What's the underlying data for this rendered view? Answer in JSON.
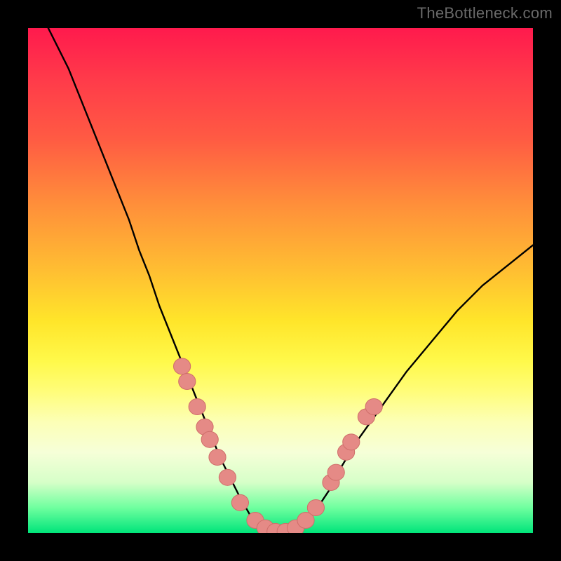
{
  "watermark": "TheBottleneck.com",
  "colors": {
    "background": "#000000",
    "curve": "#000000",
    "markerFill": "#e58a86",
    "markerStroke": "#cf6e6a",
    "gradient_top": "#ff1a4d",
    "gradient_bottom": "#00e47a"
  },
  "chart_data": {
    "type": "line",
    "title": "",
    "xlabel": "",
    "ylabel": "",
    "xlim": [
      0,
      100
    ],
    "ylim": [
      0,
      100
    ],
    "grid": false,
    "legend": false,
    "series": [
      {
        "name": "curve",
        "x": [
          4,
          6,
          8,
          10,
          12,
          14,
          16,
          18,
          20,
          22,
          24,
          26,
          28,
          30,
          32,
          34,
          36,
          38,
          40,
          42,
          44,
          46,
          48,
          50,
          52,
          54,
          56,
          58,
          60,
          62,
          65,
          70,
          75,
          80,
          85,
          90,
          95,
          100
        ],
        "y": [
          100,
          96,
          92,
          87,
          82,
          77,
          72,
          67,
          62,
          56,
          51,
          45,
          40,
          35,
          30,
          25,
          20,
          15,
          11,
          7,
          3.5,
          1.2,
          0.2,
          0,
          0.2,
          1.2,
          3.2,
          6,
          9,
          13,
          18,
          25,
          32,
          38,
          44,
          49,
          53,
          57
        ]
      }
    ],
    "markers": {
      "name": "highlighted-points",
      "points": [
        {
          "x": 30.5,
          "y": 33
        },
        {
          "x": 31.5,
          "y": 30
        },
        {
          "x": 33.5,
          "y": 25
        },
        {
          "x": 35,
          "y": 21
        },
        {
          "x": 36,
          "y": 18.5
        },
        {
          "x": 37.5,
          "y": 15
        },
        {
          "x": 39.5,
          "y": 11
        },
        {
          "x": 42,
          "y": 6
        },
        {
          "x": 45,
          "y": 2.5
        },
        {
          "x": 47,
          "y": 1
        },
        {
          "x": 49,
          "y": 0.3
        },
        {
          "x": 51,
          "y": 0.3
        },
        {
          "x": 53,
          "y": 1
        },
        {
          "x": 55,
          "y": 2.5
        },
        {
          "x": 57,
          "y": 5
        },
        {
          "x": 60,
          "y": 10
        },
        {
          "x": 61,
          "y": 12
        },
        {
          "x": 63,
          "y": 16
        },
        {
          "x": 64,
          "y": 18
        },
        {
          "x": 67,
          "y": 23
        },
        {
          "x": 68.5,
          "y": 25
        }
      ],
      "radius_y_units": 1.6
    }
  }
}
